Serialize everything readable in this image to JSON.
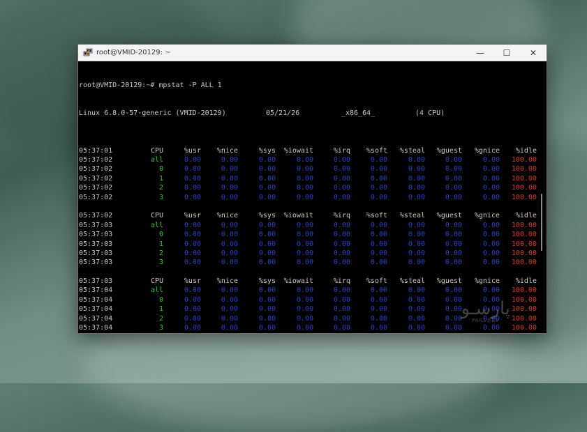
{
  "window": {
    "title": "root@VMID-20129: ~",
    "controls": {
      "minimize": "—",
      "maximize": "☐",
      "close": "✕"
    }
  },
  "terminal": {
    "prompt_line": "root@VMID-20129:~# mpstat -P ALL 1",
    "info": {
      "kernel": "Linux 6.8.0-57-generic (VMID-20129)",
      "date": "05/21/26",
      "arch": "_x86_64_",
      "cpus": "(4 CPU)"
    },
    "headers": [
      "CPU",
      "%usr",
      "%nice",
      "%sys",
      "%iowait",
      "%irq",
      "%soft",
      "%steal",
      "%guest",
      "%gnice",
      "%idle"
    ],
    "blocks": [
      {
        "header_time": "05:37:01",
        "rows": [
          {
            "time": "05:37:02",
            "cpu": "all",
            "vals": [
              "0.00",
              "0.00",
              "0.00",
              "0.00",
              "0.00",
              "0.00",
              "0.00",
              "0.00",
              "0.00"
            ],
            "idle": "100.00"
          },
          {
            "time": "05:37:02",
            "cpu": "0",
            "vals": [
              "0.00",
              "0.00",
              "0.00",
              "0.00",
              "0.00",
              "0.00",
              "0.00",
              "0.00",
              "0.00"
            ],
            "idle": "100.00"
          },
          {
            "time": "05:37:02",
            "cpu": "1",
            "vals": [
              "0.00",
              "0.00",
              "0.00",
              "0.00",
              "0.00",
              "0.00",
              "0.00",
              "0.00",
              "0.00"
            ],
            "idle": "100.00"
          },
          {
            "time": "05:37:02",
            "cpu": "2",
            "vals": [
              "0.00",
              "0.00",
              "0.00",
              "0.00",
              "0.00",
              "0.00",
              "0.00",
              "0.00",
              "0.00"
            ],
            "idle": "100.00"
          },
          {
            "time": "05:37:02",
            "cpu": "3",
            "vals": [
              "0.00",
              "0.00",
              "0.00",
              "0.00",
              "0.00",
              "0.00",
              "0.00",
              "0.00",
              "0.00"
            ],
            "idle": "100.00"
          }
        ]
      },
      {
        "header_time": "05:37:02",
        "rows": [
          {
            "time": "05:37:03",
            "cpu": "all",
            "vals": [
              "0.00",
              "0.00",
              "0.00",
              "0.00",
              "0.00",
              "0.00",
              "0.00",
              "0.00",
              "0.00"
            ],
            "idle": "100.00"
          },
          {
            "time": "05:37:03",
            "cpu": "0",
            "vals": [
              "0.00",
              "0.00",
              "0.00",
              "0.00",
              "0.00",
              "0.00",
              "0.00",
              "0.00",
              "0.00"
            ],
            "idle": "100.00"
          },
          {
            "time": "05:37:03",
            "cpu": "1",
            "vals": [
              "0.00",
              "0.00",
              "0.00",
              "0.00",
              "0.00",
              "0.00",
              "0.00",
              "0.00",
              "0.00"
            ],
            "idle": "100.00"
          },
          {
            "time": "05:37:03",
            "cpu": "2",
            "vals": [
              "0.00",
              "0.00",
              "0.00",
              "0.00",
              "0.00",
              "0.00",
              "0.00",
              "0.00",
              "0.00"
            ],
            "idle": "100.00"
          },
          {
            "time": "05:37:03",
            "cpu": "3",
            "vals": [
              "0.00",
              "0.00",
              "0.00",
              "0.00",
              "0.00",
              "0.00",
              "0.00",
              "0.00",
              "0.00"
            ],
            "idle": "100.00"
          }
        ]
      },
      {
        "header_time": "05:37:03",
        "rows": [
          {
            "time": "05:37:04",
            "cpu": "all",
            "vals": [
              "0.00",
              "0.00",
              "0.00",
              "0.00",
              "0.00",
              "0.00",
              "0.00",
              "0.00",
              "0.00"
            ],
            "idle": "100.00"
          },
          {
            "time": "05:37:04",
            "cpu": "0",
            "vals": [
              "0.00",
              "0.00",
              "0.00",
              "0.00",
              "0.00",
              "0.00",
              "0.00",
              "0.00",
              "0.00"
            ],
            "idle": "100.00"
          },
          {
            "time": "05:37:04",
            "cpu": "1",
            "vals": [
              "0.00",
              "0.00",
              "0.00",
              "0.00",
              "0.00",
              "0.00",
              "0.00",
              "0.00",
              "0.00"
            ],
            "idle": "100.00"
          },
          {
            "time": "05:37:04",
            "cpu": "2",
            "vals": [
              "0.00",
              "0.00",
              "0.00",
              "0.00",
              "0.00",
              "0.00",
              "0.00",
              "0.00",
              "0.00"
            ],
            "idle": "100.00"
          },
          {
            "time": "05:37:04",
            "cpu": "3",
            "vals": [
              "0.00",
              "0.00",
              "0.00",
              "0.00",
              "0.00",
              "0.00",
              "0.00",
              "0.00",
              "0.00"
            ],
            "idle": "100.00"
          }
        ]
      }
    ],
    "colors": {
      "cpu": "#3cbf3c",
      "values": "#2f3fc8",
      "idle": "#e03030",
      "text": "#c8c8c8"
    }
  },
  "watermark": {
    "logo": "پارسـو",
    "sub": "PARSDEV"
  }
}
